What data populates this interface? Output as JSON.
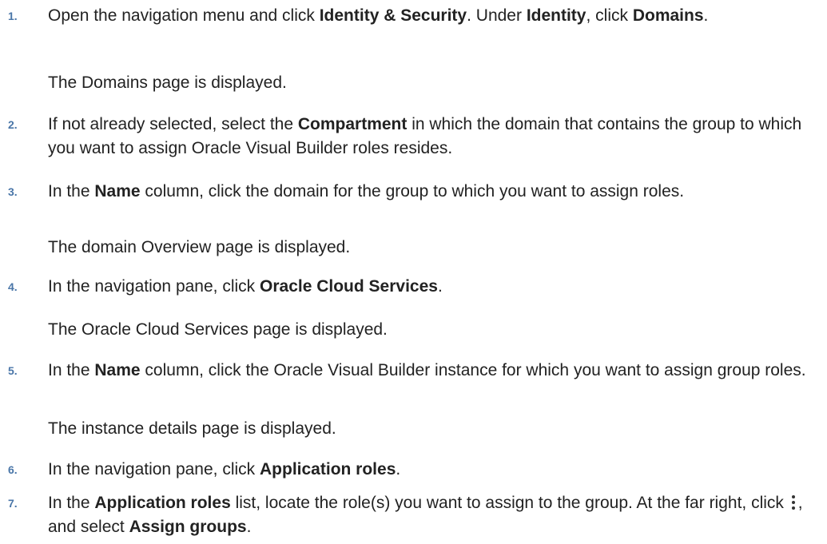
{
  "steps": [
    {
      "number": "1.",
      "parts": [
        "Open the navigation menu and click ",
        "Identity & Security",
        ". Under ",
        "Identity",
        ", click ",
        "Domains",
        "."
      ],
      "result": "The Domains page is displayed."
    },
    {
      "number": "2.",
      "parts": [
        "If not already selected, select the ",
        "Compartment",
        " in which the domain that contains the group to which you want to assign Oracle Visual Builder roles resides."
      ]
    },
    {
      "number": "3.",
      "parts": [
        "In the ",
        "Name",
        " column, click the domain for the group to which you want to assign roles."
      ],
      "result": "The domain Overview page is displayed."
    },
    {
      "number": "4.",
      "parts": [
        "In the navigation pane, click ",
        "Oracle Cloud Services",
        "."
      ],
      "result": "The Oracle Cloud Services page is displayed."
    },
    {
      "number": "5.",
      "parts": [
        "In the ",
        "Name",
        " column, click the Oracle Visual Builder instance for which you want to assign group roles."
      ],
      "result": "The instance details page is displayed."
    },
    {
      "number": "6.",
      "parts": [
        "In the navigation pane, click ",
        "Application roles",
        "."
      ]
    },
    {
      "number": "7.",
      "parts": [
        "In the ",
        "Application roles",
        " list, locate the role(s) you want to assign to the group. At the far right, click ",
        ", and select ",
        "Assign groups",
        "."
      ],
      "icon": "kebab-menu-icon"
    }
  ]
}
